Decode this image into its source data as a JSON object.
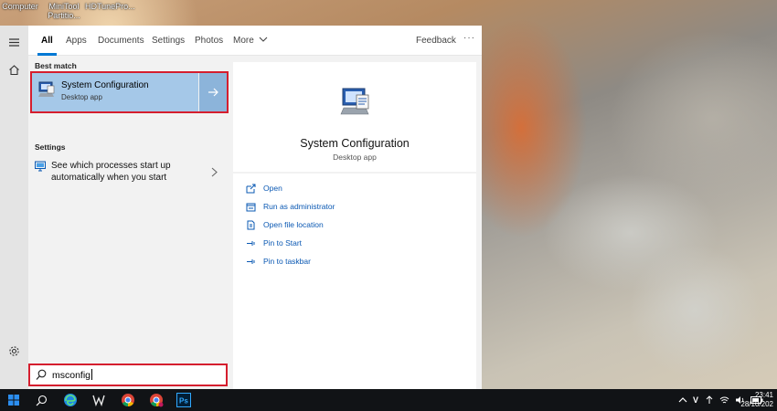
{
  "desktop": {
    "icons": [
      "Computer",
      "MiniTool\nPartitio...",
      "HDTunePro..."
    ]
  },
  "start": {
    "tabs": [
      "All",
      "Apps",
      "Documents",
      "Settings",
      "Photos",
      "More"
    ],
    "feedback": "Feedback",
    "more_dots": "···",
    "best_match_heading": "Best match",
    "best_match": {
      "title": "System Configuration",
      "subtitle": "Desktop app"
    },
    "settings_heading": "Settings",
    "settings_item": "See which processes start up automatically when you start",
    "preview": {
      "title": "System Configuration",
      "subtitle": "Desktop app",
      "actions": [
        "Open",
        "Run as administrator",
        "Open file location",
        "Pin to Start",
        "Pin to taskbar"
      ]
    },
    "search": {
      "value": "msconfig"
    }
  },
  "taskbar": {
    "apps": [
      "windows-start-icon",
      "search-icon",
      "edge-icon",
      "wordpad-icon",
      "chrome-icon",
      "chrome-profile-icon",
      "photoshop-icon"
    ],
    "tray_v": "V",
    "time": "23:41",
    "date": "28/10/202"
  },
  "colors": {
    "accent": "#0078d4",
    "highlight": "#d51e2e",
    "selected": "#a5c8e8"
  }
}
